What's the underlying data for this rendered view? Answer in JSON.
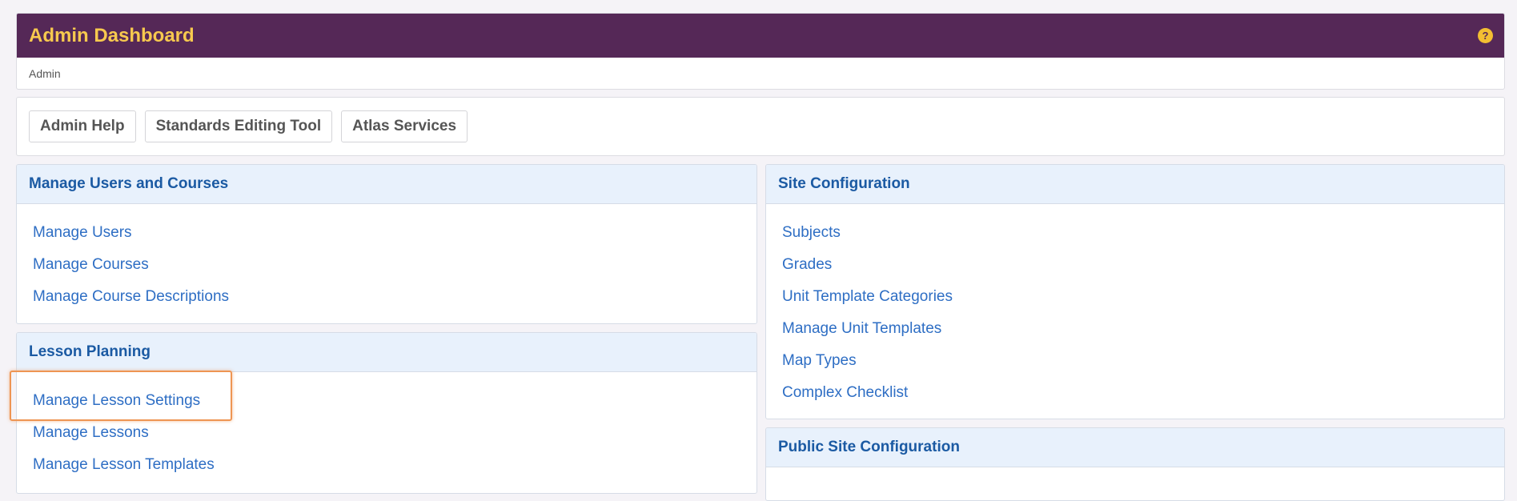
{
  "header": {
    "title": "Admin Dashboard",
    "help_icon": "?",
    "breadcrumb": "Admin"
  },
  "toolbar": {
    "buttons": [
      "Admin Help",
      "Standards Editing Tool",
      "Atlas Services"
    ]
  },
  "panels": {
    "users": {
      "title": "Manage Users and Courses",
      "links": [
        "Manage Users",
        "Manage Courses",
        "Manage Course Descriptions"
      ]
    },
    "lesson": {
      "title": "Lesson Planning",
      "links": [
        "Manage Lesson Settings",
        "Manage Lessons",
        "Manage Lesson Templates"
      ]
    },
    "site": {
      "title": "Site Configuration",
      "links": [
        "Subjects",
        "Grades",
        "Unit Template Categories",
        "Manage Unit Templates",
        "Map Types",
        "Complex Checklist"
      ]
    },
    "public": {
      "title": "Public Site Configuration"
    }
  },
  "colors": {
    "title_bar": "#552857",
    "title_text": "#f7c94e",
    "link": "#2e6ec4",
    "panel_header": "#e8f1fc",
    "highlight": "#ee9553"
  }
}
